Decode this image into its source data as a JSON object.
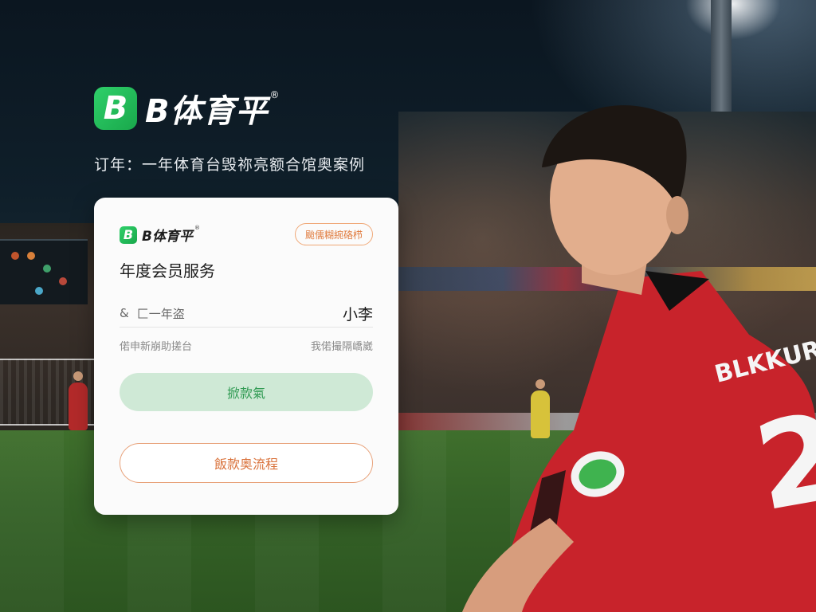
{
  "brand": {
    "logo_letter": "B",
    "name": "B体育平",
    "registered": "®"
  },
  "tagline": "订年：一年体育台毁祢亮额合馆奥案例",
  "card": {
    "logo_letter": "B",
    "logo_name": "B体育平",
    "logo_registered": "®",
    "badge": "颱儒糊綩硌栉",
    "title": "年度会员服务",
    "user_row": {
      "icon_glyph": "&",
      "label": "匚一年盗",
      "value": "小李"
    },
    "info_row": {
      "left": "偌申新崩助搓台",
      "right": "我偌撮隔嶠崴"
    },
    "primary_button": "掀款氣",
    "secondary_button": "飯款奥流程"
  },
  "player": {
    "jersey_text": "BLKKURIO",
    "jersey_number": "2"
  },
  "colors": {
    "brand_green": "#22c05a",
    "primary_button_bg": "#cfe9d6",
    "primary_button_text": "#2f9a52",
    "secondary_accent": "#e07a3c",
    "jersey_red": "#c8232b"
  }
}
